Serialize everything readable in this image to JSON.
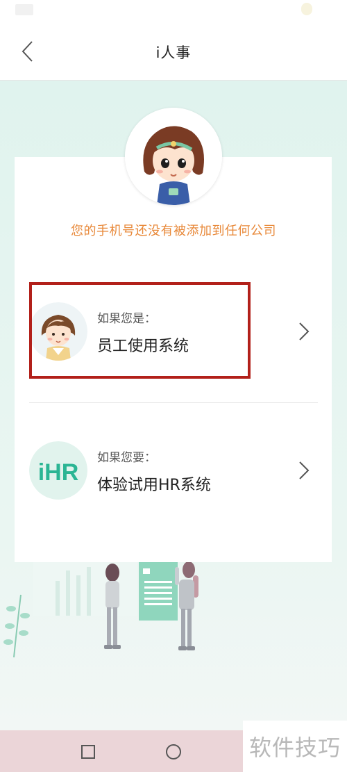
{
  "header": {
    "title": "i人事"
  },
  "notice": "您的手机号还没有被添加到任何公司",
  "options": [
    {
      "subtitle": "如果您是：",
      "title": "员工使用系统",
      "icon": "employee-avatar-icon"
    },
    {
      "subtitle": "如果您要：",
      "title": "体验试用HR系统",
      "icon": "hr-logo-icon"
    }
  ],
  "hr_logo_text": "iHR",
  "watermark": "软件技巧",
  "colors": {
    "background": "#e6f5f0",
    "notice": "#e8893a",
    "highlight": "#b2201a",
    "brand_green": "#2bb594"
  }
}
